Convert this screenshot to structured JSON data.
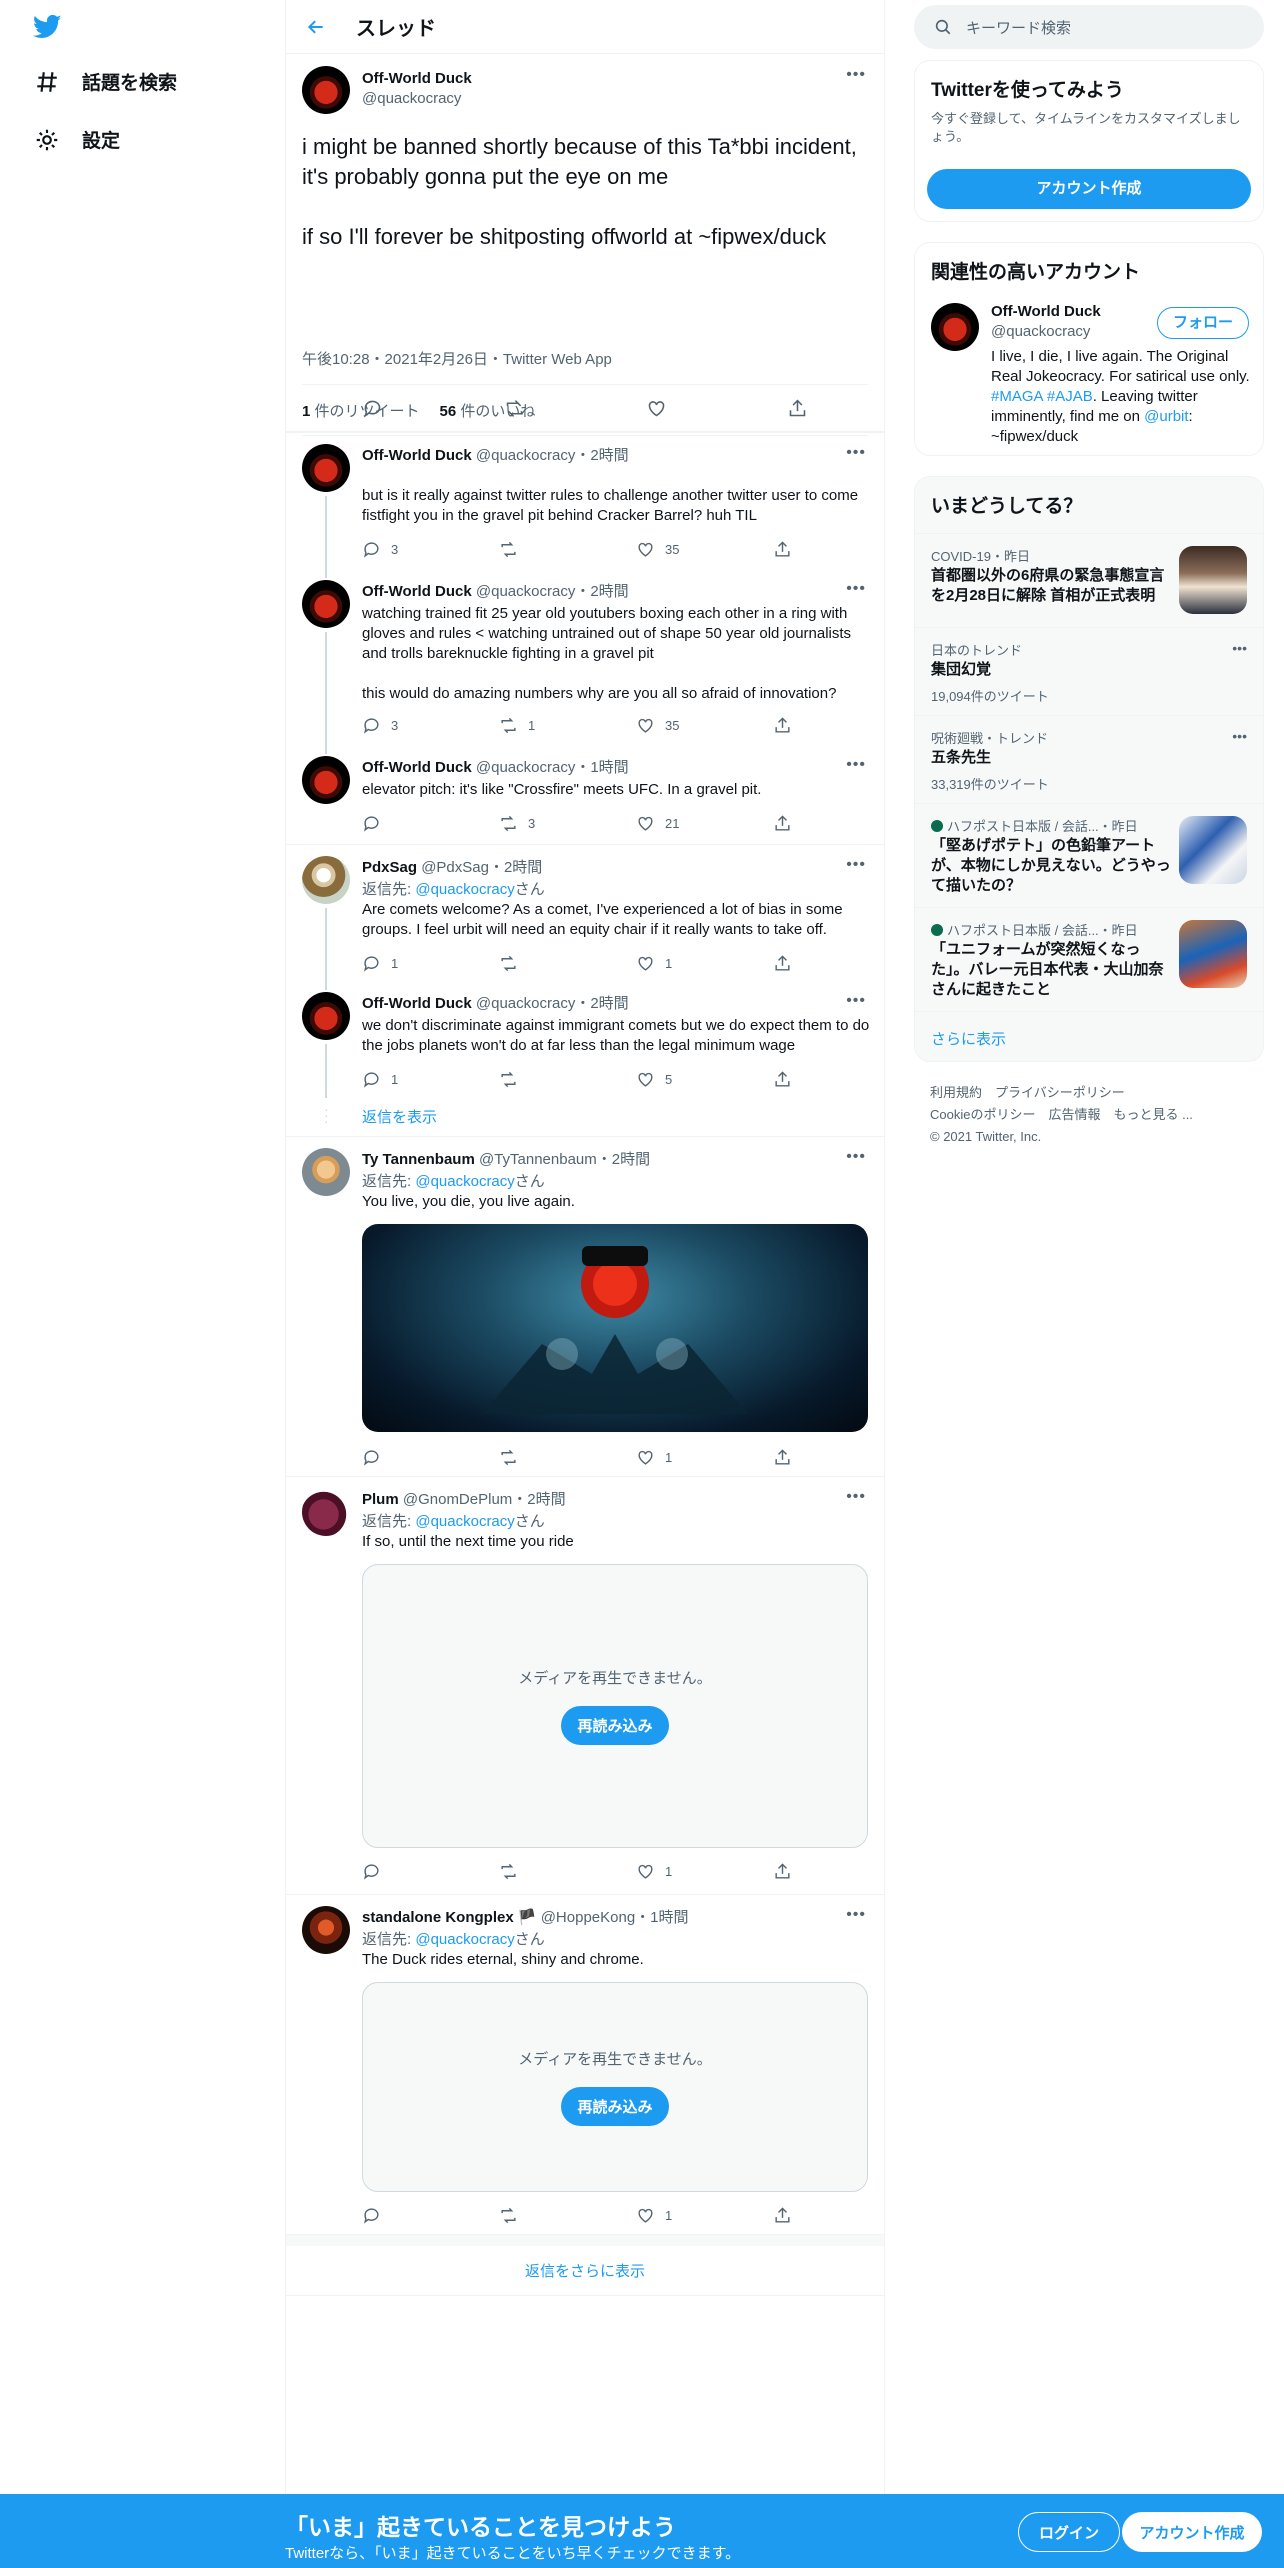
{
  "nav": {
    "explore_label": "話題を検索",
    "settings_label": "設定"
  },
  "header": {
    "title": "スレッド"
  },
  "focus_tweet": {
    "name": "Off-World Duck",
    "handle": "@quackocracy",
    "text": "i might be banned shortly because of this Ta*bbi incident, it's probably gonna put the eye on me\n\nif so I'll forever be shitposting offworld at ~fipwex/duck",
    "meta": "午後10:28・2021年2月26日・Twitter Web App",
    "retweets_count": "1",
    "retweets_label": " 件のリツイート",
    "likes_count": "56",
    "likes_label": " 件のいいね"
  },
  "replies": [
    {
      "name": "Off-World Duck",
      "handle": "@quackocracy",
      "time": "・2時間",
      "text": "but is it really against twitter rules to challenge another twitter user to come fistfight you in the gravel pit behind Cracker Barrel? huh TIL",
      "reply": "3",
      "retweet": "",
      "like": "35"
    },
    {
      "name": "Off-World Duck",
      "handle": "@quackocracy",
      "time": "・2時間",
      "text": "watching trained fit 25 year old youtubers boxing each other in a ring with gloves and rules < watching untrained out of shape 50 year old journalists and trolls bareknuckle fighting in a gravel pit\n\nthis would do amazing numbers why are you all so afraid of innovation?",
      "reply": "3",
      "retweet": "1",
      "like": "35"
    },
    {
      "name": "Off-World Duck",
      "handle": "@quackocracy",
      "time": "・1時間",
      "text": "elevator pitch: it's like \"Crossfire\" meets UFC. In a gravel pit.",
      "reply": "",
      "retweet": "3",
      "like": "21"
    },
    {
      "name": "PdxSag",
      "handle": "@PdxSag",
      "time": "・2時間",
      "reply_to_prefix": "返信先: ",
      "reply_to": "@quackocracy",
      "reply_to_suffix": "さん",
      "text": "Are comets welcome? As a comet, I've experienced a lot of bias in some groups. I feel urbit will need an equity chair if it really wants to take off.",
      "reply": "1",
      "retweet": "",
      "like": "1"
    },
    {
      "name": "Off-World Duck",
      "handle": "@quackocracy",
      "time": "・2時間",
      "text": "we don't discriminate against immigrant comets but we do expect them to do the jobs planets won't do at far less than the legal minimum wage",
      "reply": "1",
      "retweet": "",
      "like": "5"
    },
    {
      "name": "Ty Tannenbaum",
      "handle": "@TyTannenbaum",
      "time": "・2時間",
      "reply_to_prefix": "返信先: ",
      "reply_to": "@quackocracy",
      "reply_to_suffix": "さん",
      "text": "You live, you die, you live again.",
      "reply": "",
      "retweet": "",
      "like": "1"
    },
    {
      "name": "Plum",
      "handle": "@GnomDePlum",
      "time": "・2時間",
      "reply_to_prefix": "返信先: ",
      "reply_to": "@quackocracy",
      "reply_to_suffix": "さん",
      "text": "If so, until the next time you ride",
      "reply": "",
      "retweet": "",
      "like": "1"
    },
    {
      "name": "standalone Kongplex 🏴",
      "handle": "@HoppeKong",
      "time": "・1時間",
      "reply_to_prefix": "返信先: ",
      "reply_to": "@quackocracy",
      "reply_to_suffix": "さん",
      "text": "The Duck rides eternal, shiny and chrome.",
      "reply": "",
      "retweet": "",
      "like": "1"
    }
  ],
  "show_replies_label": "返信を表示",
  "media_error": {
    "message": "メディアを再生できません。",
    "reload_label": "再読み込み"
  },
  "show_more_replies_label": "返信をさらに表示",
  "search": {
    "placeholder": "キーワード検索"
  },
  "signup_card": {
    "title": "Twitterを使ってみよう",
    "desc": "今すぐ登録して、タイムラインをカスタマイズしましょう。",
    "button": "アカウント作成"
  },
  "relevant_card": {
    "title": "関連性の高いアカウント",
    "name": "Off-World Duck",
    "handle": "@quackocracy",
    "follow_label": "フォロー",
    "bio_1": "I live, I die, I live again. The Original Real Jokeocracy. For satirical use only. ",
    "bio_tags": "#MAGA #AJAB",
    "bio_2": ". Leaving twitter imminently, find me on ",
    "bio_link": "@urbit",
    "bio_3": ": ~fipwex/duck"
  },
  "trends": {
    "title": "いまどうしてる？",
    "items": [
      {
        "context": "COVID-19・昨日",
        "title": "首都圏以外の6府県の緊急事態宣言を2月28日に解除 首相が正式表明",
        "count": ""
      },
      {
        "context": "日本のトレンド",
        "title": "集団幻覚",
        "count": "19,094件のツイート"
      },
      {
        "context": "呪術廻戦・トレンド",
        "title": "五条先生",
        "count": "33,319件のツイート"
      },
      {
        "context": "ハフポスト日本版 / 会話...・昨日",
        "title": "「堅あげポテト」の色鉛筆アートが、本物にしか見えない。どうやって描いたの？",
        "count": ""
      },
      {
        "context": "ハフポスト日本版 / 会話...・昨日",
        "title": "「ユニフォームが突然短くなった」。バレー元日本代表・大山加奈さんに起きたこと",
        "count": ""
      }
    ],
    "show_more": "さらに表示"
  },
  "footer": {
    "line1": "利用規約　プライバシーポリシー",
    "line2": "Cookieのポリシー　広告情報　もっと見る ...",
    "line3": "© 2021 Twitter, Inc."
  },
  "bottom_bar": {
    "headline": "「いま」起きていることを見つけよう",
    "subline": "Twitterなら、「いま」起きていることをいち早くチェックできます。",
    "login": "ログイン",
    "signup": "アカウント作成"
  },
  "colors": {
    "accent": "#1d9bf0",
    "text": "#0f1419",
    "muted": "#536471",
    "border": "#eff3f4"
  }
}
